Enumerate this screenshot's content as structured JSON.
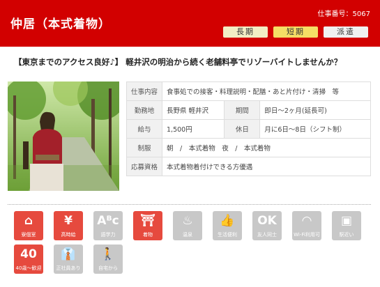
{
  "header": {
    "title": "仲居（本式着物）",
    "job_number": "仕事番号：5067",
    "tags": {
      "long": "長期",
      "short": "短期",
      "dispatch": "派遣"
    }
  },
  "headline": "【東京までのアクセス良好♪】 軽井沢の明治から続く老舗料亭でリゾーバイトしませんか？",
  "details": {
    "job_content_label": "仕事内容",
    "job_content": "食事処での接客・料理説明・配膳・あと片付け・清掃　等",
    "location_label": "勤務地",
    "location": "長野県 軽井沢",
    "period_label": "期間",
    "period": "即日～2ヶ月(延長可)",
    "salary_label": "給与",
    "salary": "1,500円",
    "holidays_label": "休日",
    "holidays": "月に6日～8日（シフト制）",
    "uniform_label": "制服",
    "uniform": "朝　/　本式着物　夜　/　本式着物",
    "qualification_label": "応募資格",
    "qualification": "本式着物着付けできる方優遇"
  },
  "features": [
    {
      "label": "寮個室",
      "icon": "house-icon",
      "glyph": "⌂",
      "active": true
    },
    {
      "label": "高時給",
      "icon": "yen-icon",
      "glyph": "¥",
      "active": true
    },
    {
      "label": "語学力",
      "icon": "abc-icon",
      "glyph": "Aᴮc",
      "active": false
    },
    {
      "label": "着物",
      "icon": "kimono-icon",
      "glyph": "⛩",
      "active": true
    },
    {
      "label": "温泉",
      "icon": "hot-spring-icon",
      "glyph": "♨",
      "active": false
    },
    {
      "label": "生活便利",
      "icon": "thumbs-up-icon",
      "glyph": "👍",
      "active": false
    },
    {
      "label": "友人同士",
      "icon": "friends-icon",
      "glyph": "OK",
      "active": false
    },
    {
      "label": "Wi-Fi利用可",
      "icon": "wifi-icon",
      "glyph": "◠",
      "active": false
    },
    {
      "label": "駅近い",
      "icon": "train-icon",
      "glyph": "▣",
      "active": false
    },
    {
      "label": "40歳～歓迎",
      "icon": "age-40-icon",
      "glyph": "40",
      "active": true
    },
    {
      "label": "正社員あり",
      "icon": "employee-icon",
      "glyph": "👔",
      "active": false
    },
    {
      "label": "自宅から",
      "icon": "commute-icon",
      "glyph": "🚶",
      "active": false
    }
  ],
  "colors": {
    "brand_red": "#d20000",
    "active_icon": "#e64a3e",
    "inactive_icon": "#c8c8c8"
  }
}
